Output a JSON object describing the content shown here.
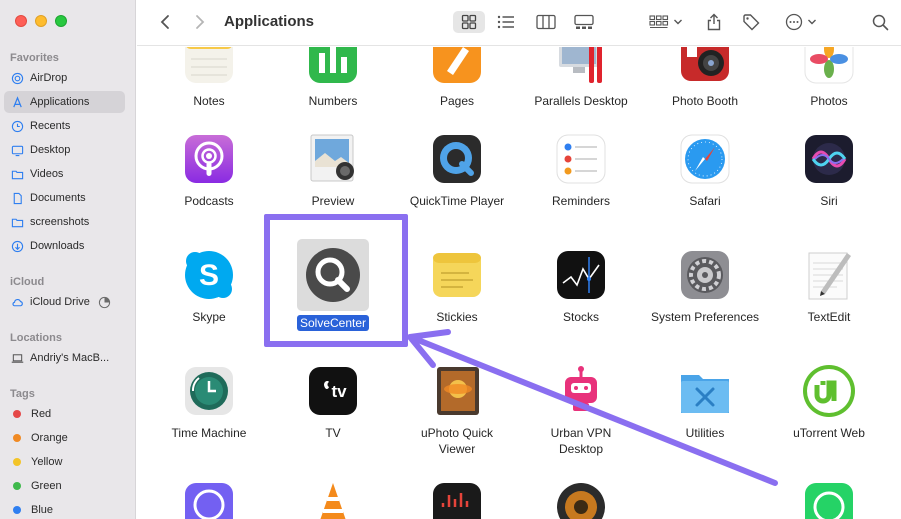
{
  "window": {
    "title": "Applications"
  },
  "sidebar": {
    "favorites_label": "Favorites",
    "favorites": [
      "AirDrop",
      "Applications",
      "Recents",
      "Desktop",
      "Videos",
      "Documents",
      "screenshots",
      "Downloads"
    ],
    "icloud_label": "iCloud",
    "icloud": [
      "iCloud Drive"
    ],
    "locations_label": "Locations",
    "locations": [
      "Andriy's MacB..."
    ],
    "tags_label": "Tags",
    "tags": [
      {
        "name": "Red",
        "color": "#e54848"
      },
      {
        "name": "Orange",
        "color": "#f08a24"
      },
      {
        "name": "Yellow",
        "color": "#f3c428"
      },
      {
        "name": "Green",
        "color": "#3fb94c"
      },
      {
        "name": "Blue",
        "color": "#2f7ff0"
      }
    ]
  },
  "apps": {
    "row1": [
      "Notes",
      "Numbers",
      "Pages",
      "Parallels Desktop",
      "Photo Booth",
      "Photos"
    ],
    "row2": [
      "Podcasts",
      "Preview",
      "QuickTime Player",
      "Reminders",
      "Safari",
      "Siri"
    ],
    "row3": [
      "Skype",
      "SolveCenter",
      "Stickies",
      "Stocks",
      "System Preferences",
      "TextEdit"
    ],
    "row4": [
      "Time Machine",
      "TV",
      "uPhoto Quick Viewer",
      "Urban VPN Desktop",
      "Utilities",
      "uTorrent Web"
    ],
    "tv_text": "tv"
  },
  "colors": {
    "highlight": "#8a6ff0",
    "selection": "#2a62d9"
  }
}
